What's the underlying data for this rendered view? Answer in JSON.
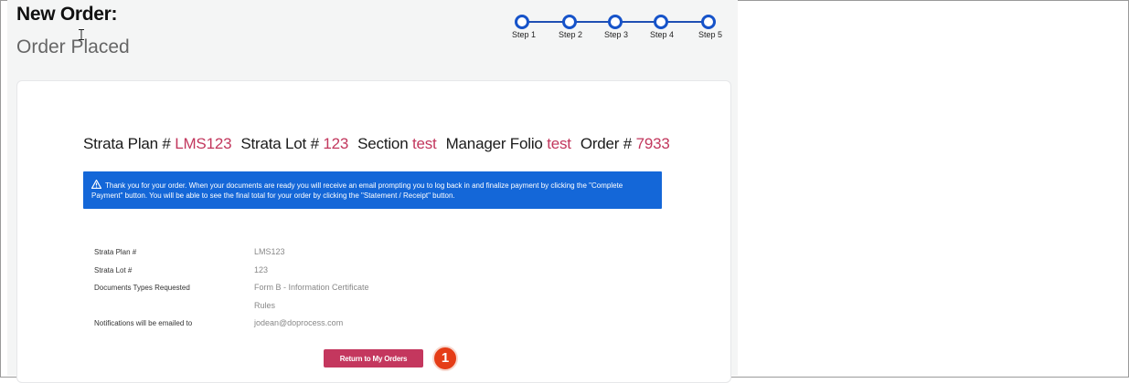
{
  "header": {
    "title": "New Order:",
    "subtitle": "Order Placed"
  },
  "steps": [
    {
      "label": "Step 1"
    },
    {
      "label": "Step 2"
    },
    {
      "label": "Step 3"
    },
    {
      "label": "Step 4"
    },
    {
      "label": "Step 5"
    }
  ],
  "summary": {
    "strata_plan_label": "Strata Plan #",
    "strata_plan_value": "LMS123",
    "strata_lot_label": "Strata Lot #",
    "strata_lot_value": "123",
    "section_label": "Section",
    "section_value": "test",
    "manager_folio_label": "Manager Folio",
    "manager_folio_value": "test",
    "order_label": "Order #",
    "order_value": "7933"
  },
  "notice": {
    "text": "Thank you for your order. When your documents are ready you will receive an email prompting you to log back in and finalize payment by clicking the \"Complete Payment\" button. You will be able to see the final total for your order by clicking the \"Statement / Receipt\" button."
  },
  "details": {
    "strata_plan_label": "Strata Plan #",
    "strata_plan_value": "LMS123",
    "strata_lot_label": "Strata Lot #",
    "strata_lot_value": "123",
    "documents_label": "Documents Types Requested",
    "documents": [
      "Form B - Information Certificate",
      "Rules"
    ],
    "notifications_label": "Notifications will be emailed to",
    "notifications_value": "jodean@doprocess.com"
  },
  "actions": {
    "return_label": "Return to My Orders"
  },
  "annotation": {
    "badge_number": "1"
  },
  "colors": {
    "accent": "#c4375e",
    "notice_bg": "#1467d8",
    "step_blue": "#1653c9",
    "badge": "#e53d17"
  }
}
